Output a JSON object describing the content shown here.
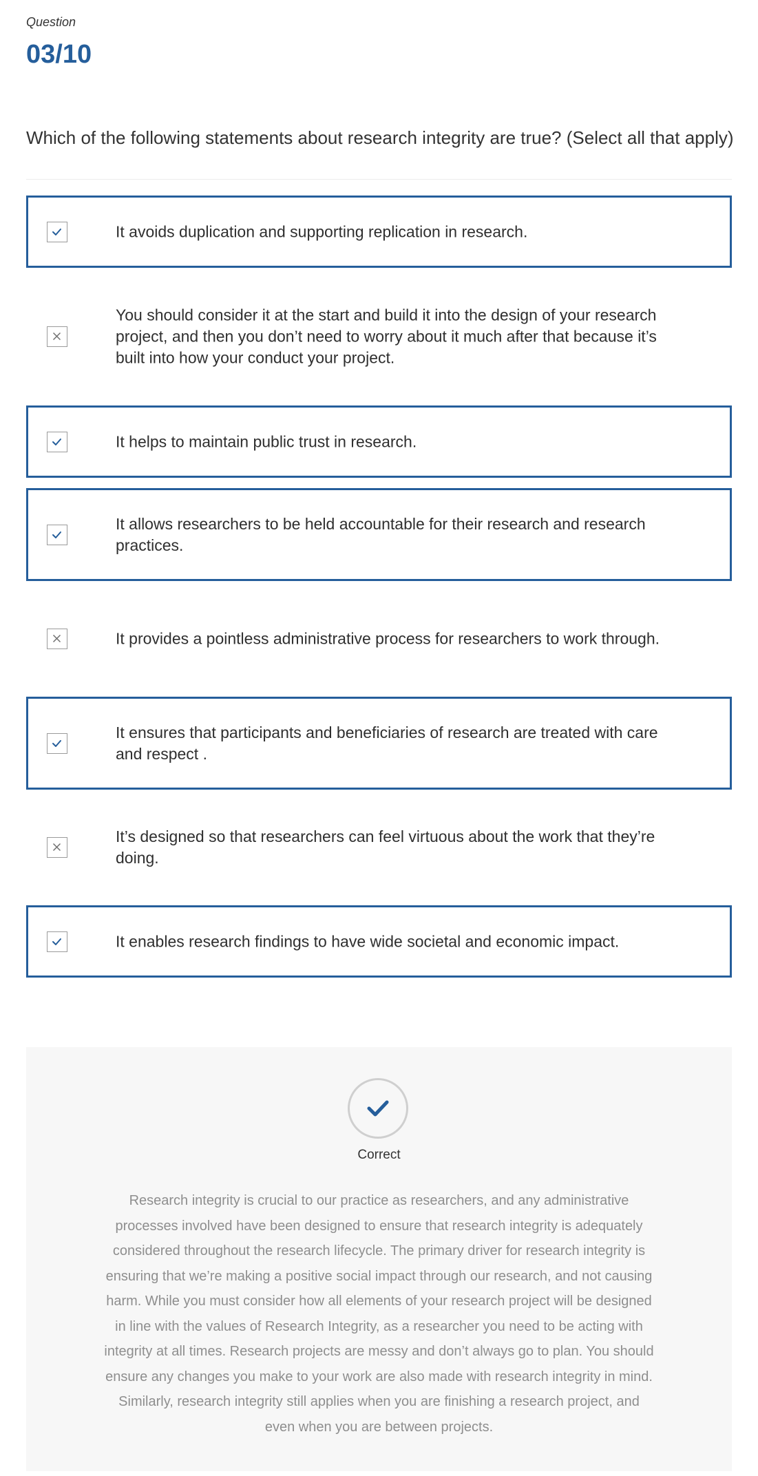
{
  "question": {
    "label": "Question",
    "number": "03/10",
    "prompt": "Which of the following statements about research integrity are true? (Select all that apply)"
  },
  "options": [
    {
      "text": "It avoids duplication and supporting replication in research.",
      "selected": true
    },
    {
      "text": "You should consider it at the start and build it into the design of your research project, and then you don’t need to worry about it much after that because it’s built into how your conduct your project.",
      "selected": false
    },
    {
      "text": "It helps to maintain public trust in research.",
      "selected": true
    },
    {
      "text": "It allows researchers to be held accountable for their research and research practices.",
      "selected": true
    },
    {
      "text": "It provides a pointless administrative process for researchers to work through.",
      "selected": false
    },
    {
      "text": "It ensures that participants and beneficiaries of research are treated with care and respect .",
      "selected": true
    },
    {
      "text": "It’s designed so that researchers can feel virtuous about the work that they’re doing.",
      "selected": false
    },
    {
      "text": "It enables research findings to have wide societal and economic impact.",
      "selected": true
    }
  ],
  "feedback": {
    "result": "Correct",
    "result_icon": "checkmark-icon",
    "explanation": "Research integrity is crucial to our practice as researchers, and any administrative processes involved have been designed to ensure that research integrity is adequately considered throughout the research lifecycle. The primary driver for research integrity is ensuring that we’re making a positive social impact through our research, and not causing harm.  While you must consider how all elements of your research project will be designed in line with the values of Research Integrity, as a researcher you need to be acting with integrity at all times. Research projects are messy and don’t always go to plan. You should ensure any changes you make to your work are also made with research integrity in mind. Similarly, research integrity still applies when you are finishing a research project, and even when you are between projects."
  },
  "colors": {
    "accent": "#255e9b",
    "option_text": "#2f2f2f",
    "explanation_text": "#8e8e8e",
    "feedback_background": "#f7f7f7"
  }
}
